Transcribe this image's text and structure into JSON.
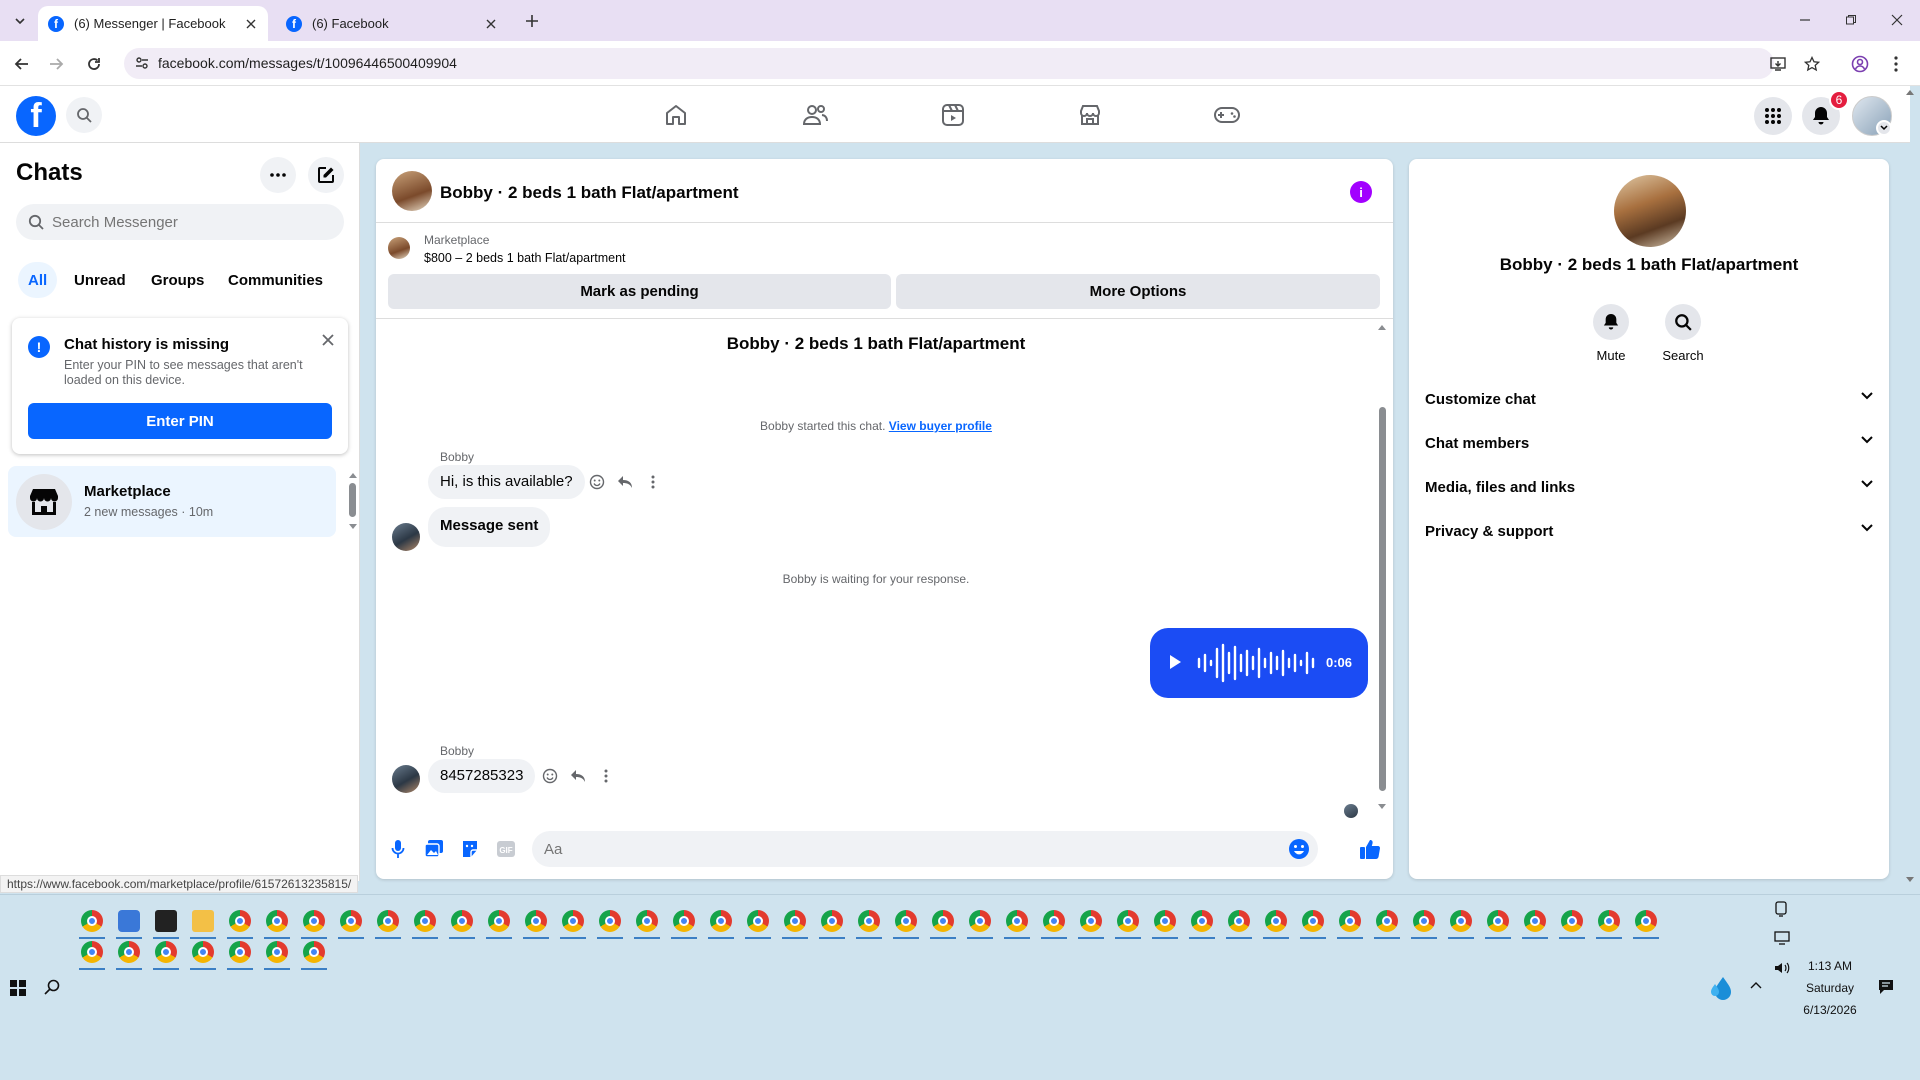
{
  "browser": {
    "tabs": [
      {
        "title": "(6) Messenger | Facebook",
        "active": true
      },
      {
        "title": "(6) Facebook",
        "active": false
      }
    ],
    "url": "facebook.com/messages/t/10096446500409904"
  },
  "fb_nav": {
    "notification_count": "6"
  },
  "chats": {
    "title": "Chats",
    "search_placeholder": "Search Messenger",
    "filters": [
      "All",
      "Unread",
      "Groups",
      "Communities"
    ],
    "notice": {
      "title": "Chat history is missing",
      "body": "Enter your PIN to see messages that aren't loaded on this device.",
      "button": "Enter PIN"
    },
    "items": [
      {
        "name": "Marketplace",
        "subtitle": "2 new messages · 10m"
      }
    ]
  },
  "status_bar_url": "https://www.facebook.com/marketplace/profile/61572613235815/",
  "conversation": {
    "header_name": "Bobby · 2 beds 1 bath Flat/apartment",
    "marketplace": {
      "label": "Marketplace",
      "listing": "$800 – 2 beds 1 bath Flat/apartment",
      "buttons": [
        "Mark as pending",
        "More Options"
      ]
    },
    "thread_title": "Bobby · 2 beds 1 bath Flat/apartment",
    "started_text": "Bobby started this chat.",
    "view_profile_link": "View buyer profile",
    "messages": [
      {
        "sender": "Bobby",
        "text": "Hi, is this available?"
      },
      {
        "sender": "",
        "text": "Message sent"
      },
      {
        "sender": "",
        "text": "Bobby is waiting for your response."
      },
      {
        "sender": "me",
        "type": "voice",
        "duration": "0:06"
      },
      {
        "sender": "Bobby",
        "text": "8457285323"
      }
    ],
    "composer_placeholder": "Aa"
  },
  "info_panel": {
    "name": "Bobby · 2 beds 1 bath Flat/apartment",
    "actions": [
      "Mute",
      "Search"
    ],
    "sections": [
      "Customize chat",
      "Chat members",
      "Media, files and links",
      "Privacy & support"
    ]
  },
  "taskbar": {
    "time": "1:13 AM",
    "day": "Saturday",
    "date": "6/13/2026"
  },
  "colors": {
    "fb_blue": "#0866ff",
    "voice_bubble": "#1b4cf4",
    "info_purple": "#a200ff",
    "badge_red": "#e41e3f"
  }
}
